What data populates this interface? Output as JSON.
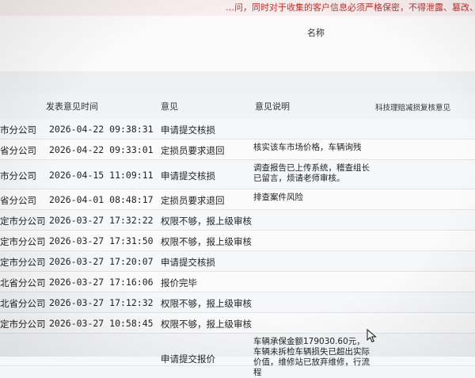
{
  "notice": "…问，同时对于收集的客户信息必须严格保密，不得泄露、篡改、出…",
  "top_header": {
    "name_label": "名称"
  },
  "table": {
    "headers": {
      "time": "发表意见时间",
      "opinion": "意见",
      "description": "意见说明",
      "tech_review": "科技理赔减损复核意见"
    },
    "rows": [
      {
        "org": "市分公司",
        "time": "2026-04-22 09:38:31",
        "opinion": "申请提交核损",
        "desc": ""
      },
      {
        "org": "省分公司",
        "time": "2026-04-22 09:33:01",
        "opinion": "定损员要求退回",
        "desc": "核实该车市场价格，车辆询残"
      },
      {
        "org": "市分公司",
        "time": "2026-04-15 11:09:11",
        "opinion": "申请提交核损",
        "desc": "调查报告已上传系统，稽查组长已留言，烦请老师审核。"
      },
      {
        "org": "省分公司",
        "time": "2026-04-01 08:48:17",
        "opinion": "定损员要求退回",
        "desc": "排查案件风险"
      },
      {
        "org": "定市分公司",
        "time": "2026-03-27 17:32:22",
        "opinion": "权限不够，报上级审核",
        "desc": ""
      },
      {
        "org": "定市分公司",
        "time": "2026-03-27 17:31:50",
        "opinion": "权限不够，报上级审核",
        "desc": ""
      },
      {
        "org": "定市分公司",
        "time": "2026-03-27 17:20:07",
        "opinion": "申请提交核损",
        "desc": ""
      },
      {
        "org": "北省分公司",
        "time": "2026-03-27 17:16:06",
        "opinion": "报价完毕",
        "desc": ""
      },
      {
        "org": "北省分公司",
        "time": "2026-03-27 17:12:32",
        "opinion": "权限不够，报上级审核",
        "desc": ""
      },
      {
        "org": "定市分公司",
        "time": "2026-03-27 10:58:45",
        "opinion": "权限不够，报上级审核",
        "desc": ""
      },
      {
        "org": "",
        "time": "",
        "opinion": "申请提交报价",
        "desc": "车辆承保金额179030.60元，车辆未拆检车辆损失已超出实际价值，维修站已放弃维修，行流程"
      }
    ]
  },
  "cursor_icon": "mouse-pointer-icon"
}
